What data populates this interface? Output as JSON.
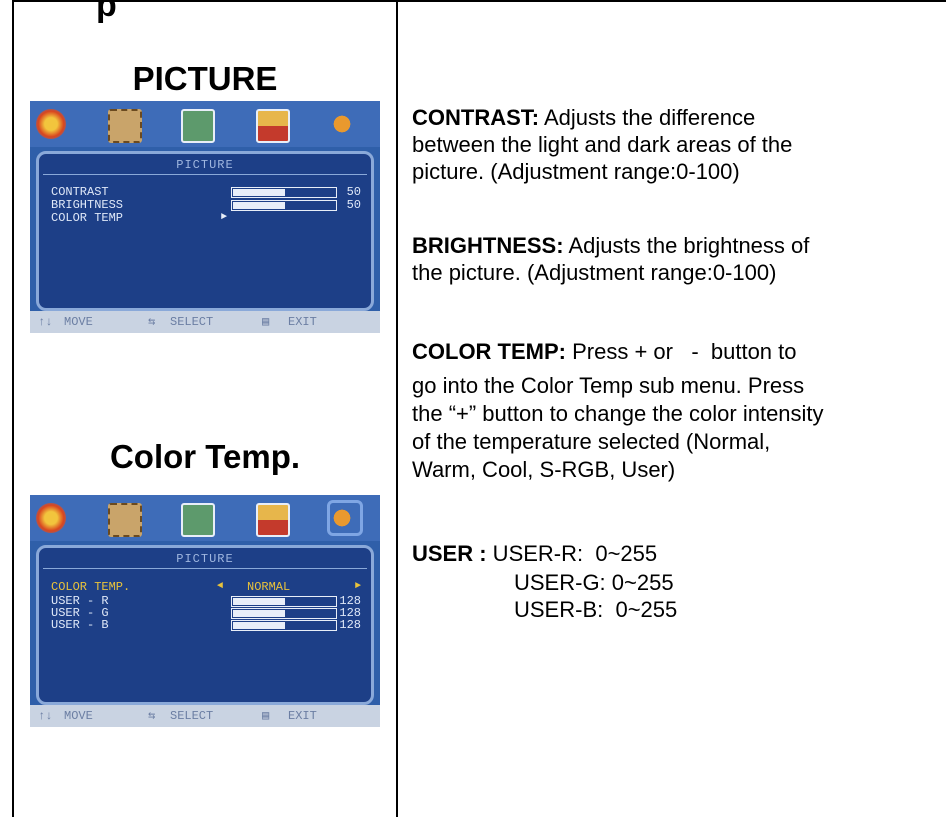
{
  "top_title_fragment": "p",
  "sections": {
    "picture": {
      "heading": "PICTURE",
      "osd": {
        "panel_title": "PICTURE",
        "rows": [
          {
            "label": "CONTRAST",
            "value": "50",
            "level": 0.5
          },
          {
            "label": "BRIGHTNESS",
            "value": "50",
            "level": 0.5
          },
          {
            "label": "COLOR TEMP",
            "arrow": "►"
          }
        ],
        "footer": {
          "move": "MOVE",
          "select": "SELECT",
          "exit": "EXIT"
        },
        "icons": [
          "color-wheel-icon",
          "film-icon",
          "clock-icon",
          "screen-icon",
          "speaker-icon"
        ]
      }
    },
    "color_temp": {
      "heading": "Color  Temp.",
      "osd": {
        "panel_title": "PICTURE",
        "temp_label": "COLOR TEMP.",
        "temp_value": "NORMAL",
        "left_arrow": "◄",
        "right_arrow": "►",
        "rows": [
          {
            "label": "USER - R",
            "value": "128",
            "level": 0.5
          },
          {
            "label": "USER - G",
            "value": "128",
            "level": 0.5
          },
          {
            "label": "USER - B",
            "value": "128",
            "level": 0.5
          }
        ],
        "footer": {
          "move": "MOVE",
          "select": "SELECT",
          "exit": "EXIT"
        }
      }
    }
  },
  "descriptions": {
    "contrast": {
      "term": "CONTRAST:",
      "lines": [
        " Adjusts the difference",
        "between the light and dark areas of the",
        "picture. (Adjustment range:0-100)"
      ]
    },
    "brightness": {
      "term": "BRIGHTNESS:",
      "lines": [
        " Adjusts the brightness of",
        "the picture. (Adjustment range:0-100)"
      ]
    },
    "color_temp": {
      "term": "COLOR TEMP:",
      "lines": [
        " Press + or   -  button to",
        "go into the Color Temp sub menu. Press",
        "the “+” button to change the color intensity",
        "of the temperature selected (Normal,",
        "Warm, Cool, S-RGB, User)"
      ]
    },
    "user": {
      "term": "USER :",
      "r": " USER-R:  0~255",
      "g": "USER-G: 0~255",
      "b": "USER-B:  0~255"
    }
  },
  "colors": {
    "osd_bg": "#2f5fa9",
    "osd_panel": "#1d3f87",
    "osd_footer": "#c9d3e2"
  }
}
